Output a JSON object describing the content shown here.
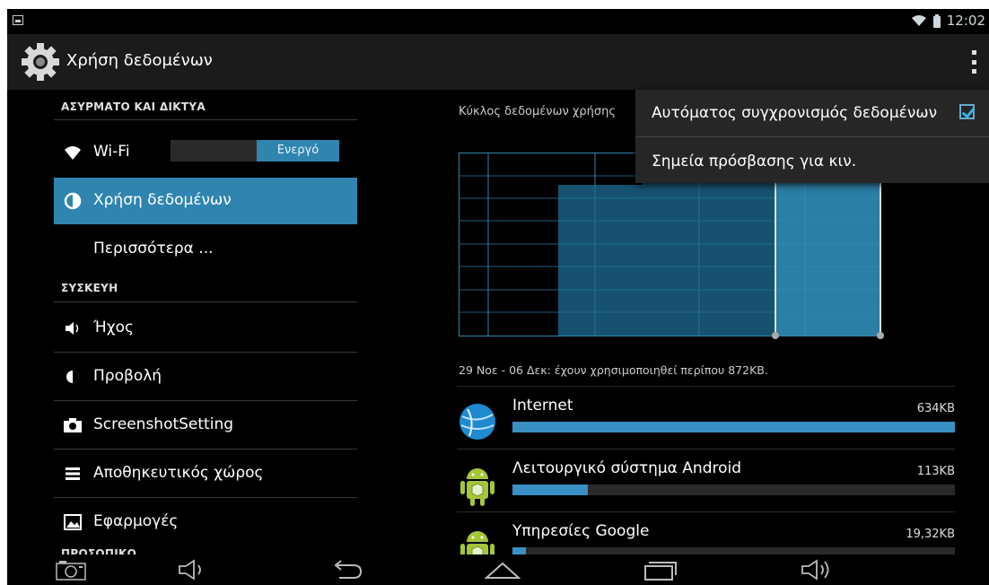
{
  "status_bar": {
    "time": "12:02",
    "icons": [
      "screenshot-notification-icon",
      "wifi-icon",
      "battery-icon"
    ]
  },
  "action_bar": {
    "title": "Χρήση δεδομένων",
    "icon": "gear-icon",
    "overflow_icon": "overflow-menu-icon"
  },
  "sidebar": {
    "sections": [
      {
        "title": "ΑΣΥΡΜΑΤΟ ΚΑΙ ΔΙΚΤΥΑ"
      },
      {
        "title": "ΣΥΣΚΕΥΗ"
      },
      {
        "title": "ΠΡΟΣΩΠΙΚΟ"
      }
    ],
    "items": [
      {
        "label": "Wi-Fi",
        "icon": "wifi-icon",
        "toggle": "Ενεργό"
      },
      {
        "label": "Χρήση δεδομένων",
        "icon": "data-usage-icon",
        "selected": true
      },
      {
        "label": "Περισσότερα ...",
        "icon": ""
      },
      {
        "label": "Ήχος",
        "icon": "speaker-icon"
      },
      {
        "label": "Προβολή",
        "icon": "brightness-icon"
      },
      {
        "label": "ScreenshotSetting",
        "icon": "camera-icon"
      },
      {
        "label": "Αποθηκευτικός χώρος",
        "icon": "storage-icon"
      },
      {
        "label": "Εφαρμογές",
        "icon": "apps-icon"
      }
    ]
  },
  "data_usage": {
    "cycle_label": "Κύκλος δεδομένων χρήσης",
    "range_text": "29 Νοε - 06 Δεκ: έχουν χρησιμοποιηθεί περίπου 872KB.",
    "apps": [
      {
        "name": "Internet",
        "size": "634KB",
        "fraction": 1.0,
        "icon": "globe-icon"
      },
      {
        "name": "Λειτουργικό σύστημα Android",
        "size": "113KB",
        "fraction": 0.17,
        "icon": "android-icon"
      },
      {
        "name": "Υπηρεσίες Google",
        "size": "19,32KB",
        "fraction": 0.03,
        "icon": "android-icon"
      }
    ]
  },
  "popup_menu": {
    "items": [
      {
        "label": "Αυτόματος συγχρονισμός δεδομένων",
        "checked": true
      },
      {
        "label": "Σημεία πρόσβασης για κιν."
      }
    ]
  },
  "nav_bar": {
    "buttons": [
      "screenshot-icon",
      "volume-down-icon",
      "back-icon",
      "home-icon",
      "recent-apps-icon",
      "volume-up-icon"
    ]
  },
  "colors": {
    "accent": "#2f85b0",
    "background": "#000000",
    "action_bar": "#1b1b1b"
  }
}
